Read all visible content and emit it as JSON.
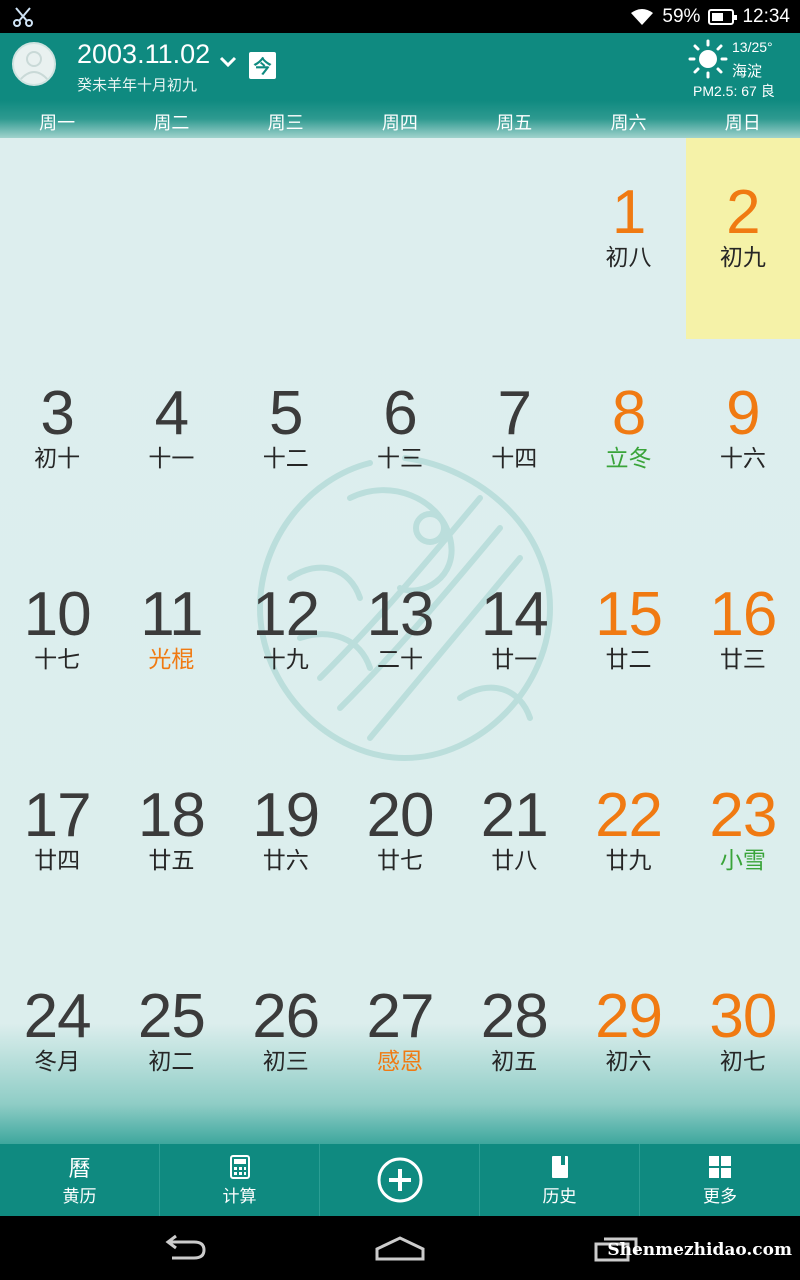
{
  "status_bar": {
    "battery": "59%",
    "battery_level": 0.59,
    "time": "12:34"
  },
  "header": {
    "date": "2003.11.02",
    "today_label": "今",
    "lunar_date": "癸未羊年十月初九",
    "weather": {
      "temp": "13/25°",
      "location": "海淀",
      "pm25": "PM2.5:  67 良"
    }
  },
  "weekdays": [
    "周一",
    "周二",
    "周三",
    "周四",
    "周五",
    "周六",
    "周日"
  ],
  "calendar": {
    "selected_day": "2",
    "days": [
      {
        "day": "1",
        "lunar": "初八",
        "col": 5,
        "row": 0,
        "kind": "normal"
      },
      {
        "day": "2",
        "lunar": "初九",
        "col": 6,
        "row": 0,
        "kind": "normal"
      },
      {
        "day": "3",
        "lunar": "初十",
        "col": 0,
        "row": 1,
        "kind": "normal"
      },
      {
        "day": "4",
        "lunar": "十一",
        "col": 1,
        "row": 1,
        "kind": "normal"
      },
      {
        "day": "5",
        "lunar": "十二",
        "col": 2,
        "row": 1,
        "kind": "normal"
      },
      {
        "day": "6",
        "lunar": "十三",
        "col": 3,
        "row": 1,
        "kind": "normal"
      },
      {
        "day": "7",
        "lunar": "十四",
        "col": 4,
        "row": 1,
        "kind": "normal"
      },
      {
        "day": "8",
        "lunar": "立冬",
        "col": 5,
        "row": 1,
        "kind": "term"
      },
      {
        "day": "9",
        "lunar": "十六",
        "col": 6,
        "row": 1,
        "kind": "normal"
      },
      {
        "day": "10",
        "lunar": "十七",
        "col": 0,
        "row": 2,
        "kind": "normal"
      },
      {
        "day": "11",
        "lunar": "光棍",
        "col": 1,
        "row": 2,
        "kind": "festival"
      },
      {
        "day": "12",
        "lunar": "十九",
        "col": 2,
        "row": 2,
        "kind": "normal"
      },
      {
        "day": "13",
        "lunar": "二十",
        "col": 3,
        "row": 2,
        "kind": "normal"
      },
      {
        "day": "14",
        "lunar": "廿一",
        "col": 4,
        "row": 2,
        "kind": "normal"
      },
      {
        "day": "15",
        "lunar": "廿二",
        "col": 5,
        "row": 2,
        "kind": "normal"
      },
      {
        "day": "16",
        "lunar": "廿三",
        "col": 6,
        "row": 2,
        "kind": "normal"
      },
      {
        "day": "17",
        "lunar": "廿四",
        "col": 0,
        "row": 3,
        "kind": "normal"
      },
      {
        "day": "18",
        "lunar": "廿五",
        "col": 1,
        "row": 3,
        "kind": "normal"
      },
      {
        "day": "19",
        "lunar": "廿六",
        "col": 2,
        "row": 3,
        "kind": "normal"
      },
      {
        "day": "20",
        "lunar": "廿七",
        "col": 3,
        "row": 3,
        "kind": "normal"
      },
      {
        "day": "21",
        "lunar": "廿八",
        "col": 4,
        "row": 3,
        "kind": "normal"
      },
      {
        "day": "22",
        "lunar": "廿九",
        "col": 5,
        "row": 3,
        "kind": "normal"
      },
      {
        "day": "23",
        "lunar": "小雪",
        "col": 6,
        "row": 3,
        "kind": "term"
      },
      {
        "day": "24",
        "lunar": "冬月",
        "col": 0,
        "row": 4,
        "kind": "normal"
      },
      {
        "day": "25",
        "lunar": "初二",
        "col": 1,
        "row": 4,
        "kind": "normal"
      },
      {
        "day": "26",
        "lunar": "初三",
        "col": 2,
        "row": 4,
        "kind": "normal"
      },
      {
        "day": "27",
        "lunar": "感恩",
        "col": 3,
        "row": 4,
        "kind": "festival"
      },
      {
        "day": "28",
        "lunar": "初五",
        "col": 4,
        "row": 4,
        "kind": "normal"
      },
      {
        "day": "29",
        "lunar": "初六",
        "col": 5,
        "row": 4,
        "kind": "normal"
      },
      {
        "day": "30",
        "lunar": "初七",
        "col": 6,
        "row": 4,
        "kind": "normal"
      }
    ]
  },
  "tabs": [
    {
      "id": "almanac",
      "icon_text": "曆",
      "label": "黄历"
    },
    {
      "id": "calculator",
      "label": "计算"
    },
    {
      "id": "add",
      "label": ""
    },
    {
      "id": "history",
      "label": "历史"
    },
    {
      "id": "more",
      "label": "更多"
    }
  ],
  "watermark_text": "Shenmezhidao.com",
  "colors": {
    "teal": "#0f8a80",
    "weekend": "#f07a12",
    "solar_term": "#3aa43a",
    "selected": "#f5f2a8"
  }
}
